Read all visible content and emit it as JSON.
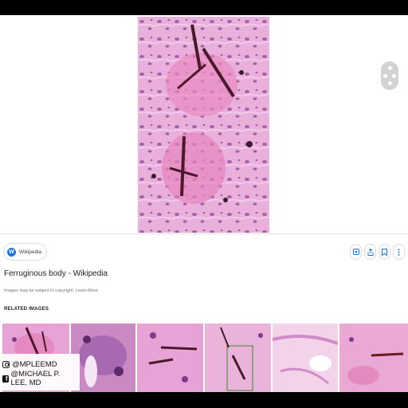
{
  "source": {
    "label": "Wikipedia",
    "logo_letter": "W"
  },
  "result": {
    "title": "Ferruginous body - Wikipedia",
    "copyright_note": "Images may be subject to copyright. Learn More"
  },
  "actions": [
    {
      "name": "lens-search-button",
      "icon": "lens-icon"
    },
    {
      "name": "share-button",
      "icon": "share-icon"
    },
    {
      "name": "save-button",
      "icon": "bookmark-icon"
    },
    {
      "name": "more-button",
      "icon": "more-vert-icon"
    }
  ],
  "related": {
    "heading": "RELATED IMAGES",
    "thumb_count": 6
  },
  "watermark": {
    "instagram": "@MPLEEMD",
    "facebook": "@MICHAEL P. LEE, MD"
  },
  "colors": {
    "accent": "#1a73e8",
    "tissue_pink": "#e7a3d5",
    "stain_dark": "#4a1a2a"
  }
}
